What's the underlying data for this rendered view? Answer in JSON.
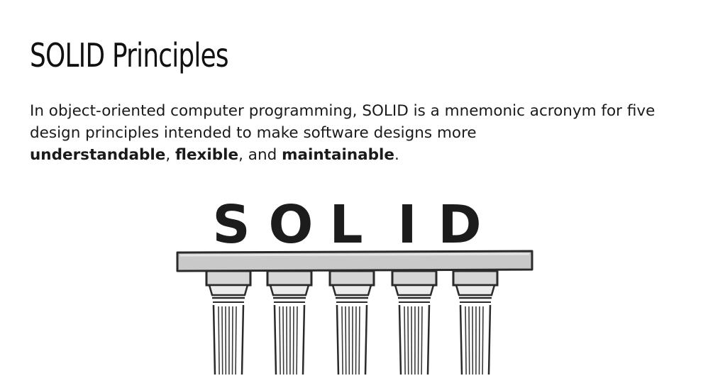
{
  "slide": {
    "title": "SOLID Principles",
    "paragraph": {
      "intro": "In object-oriented computer programming, SOLID is a mnemonic acronym for five design principles intended to make software designs more",
      "term1": "understandable",
      "sep1": ",",
      "term2": "flexible",
      "sep2": ", and",
      "term3": "maintainable",
      "end": "."
    },
    "illustration": {
      "letters": [
        "S",
        "O",
        "L",
        "I",
        "D"
      ],
      "pillar_count": 5
    }
  }
}
